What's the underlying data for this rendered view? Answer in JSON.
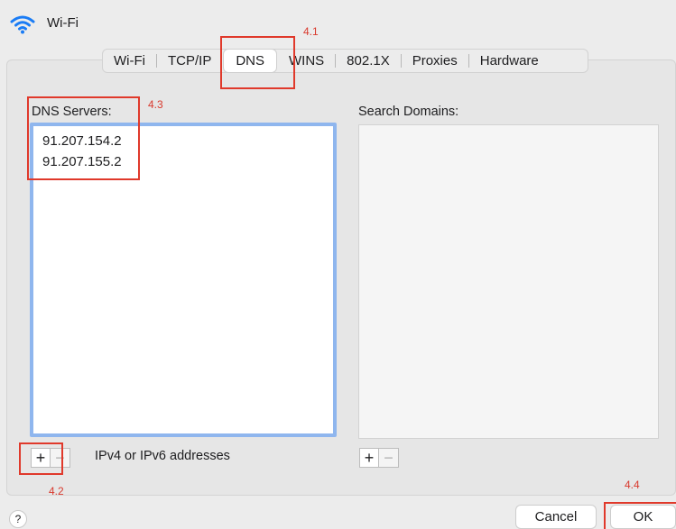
{
  "window": {
    "title": "Wi-Fi",
    "icon": "wifi-icon"
  },
  "tabs": [
    {
      "label": "Wi-Fi",
      "active": false
    },
    {
      "label": "TCP/IP",
      "active": false
    },
    {
      "label": "DNS",
      "active": true
    },
    {
      "label": "WINS",
      "active": false
    },
    {
      "label": "802.1X",
      "active": false
    },
    {
      "label": "Proxies",
      "active": false
    },
    {
      "label": "Hardware",
      "active": false
    }
  ],
  "dns": {
    "label": "DNS Servers:",
    "servers": [
      "91.207.154.2",
      "91.207.155.2"
    ],
    "add_label": "+",
    "remove_label": "−",
    "hint": "IPv4 or IPv6 addresses"
  },
  "search": {
    "label": "Search Domains:",
    "add_label": "+",
    "remove_label": "−"
  },
  "annotations": {
    "a41": "4.1",
    "a42": "4.2",
    "a43": "4.3",
    "a44": "4.4",
    "color": "#e0392b"
  },
  "footer": {
    "help_label": "?",
    "cancel_label": "Cancel",
    "ok_label": "OK"
  }
}
